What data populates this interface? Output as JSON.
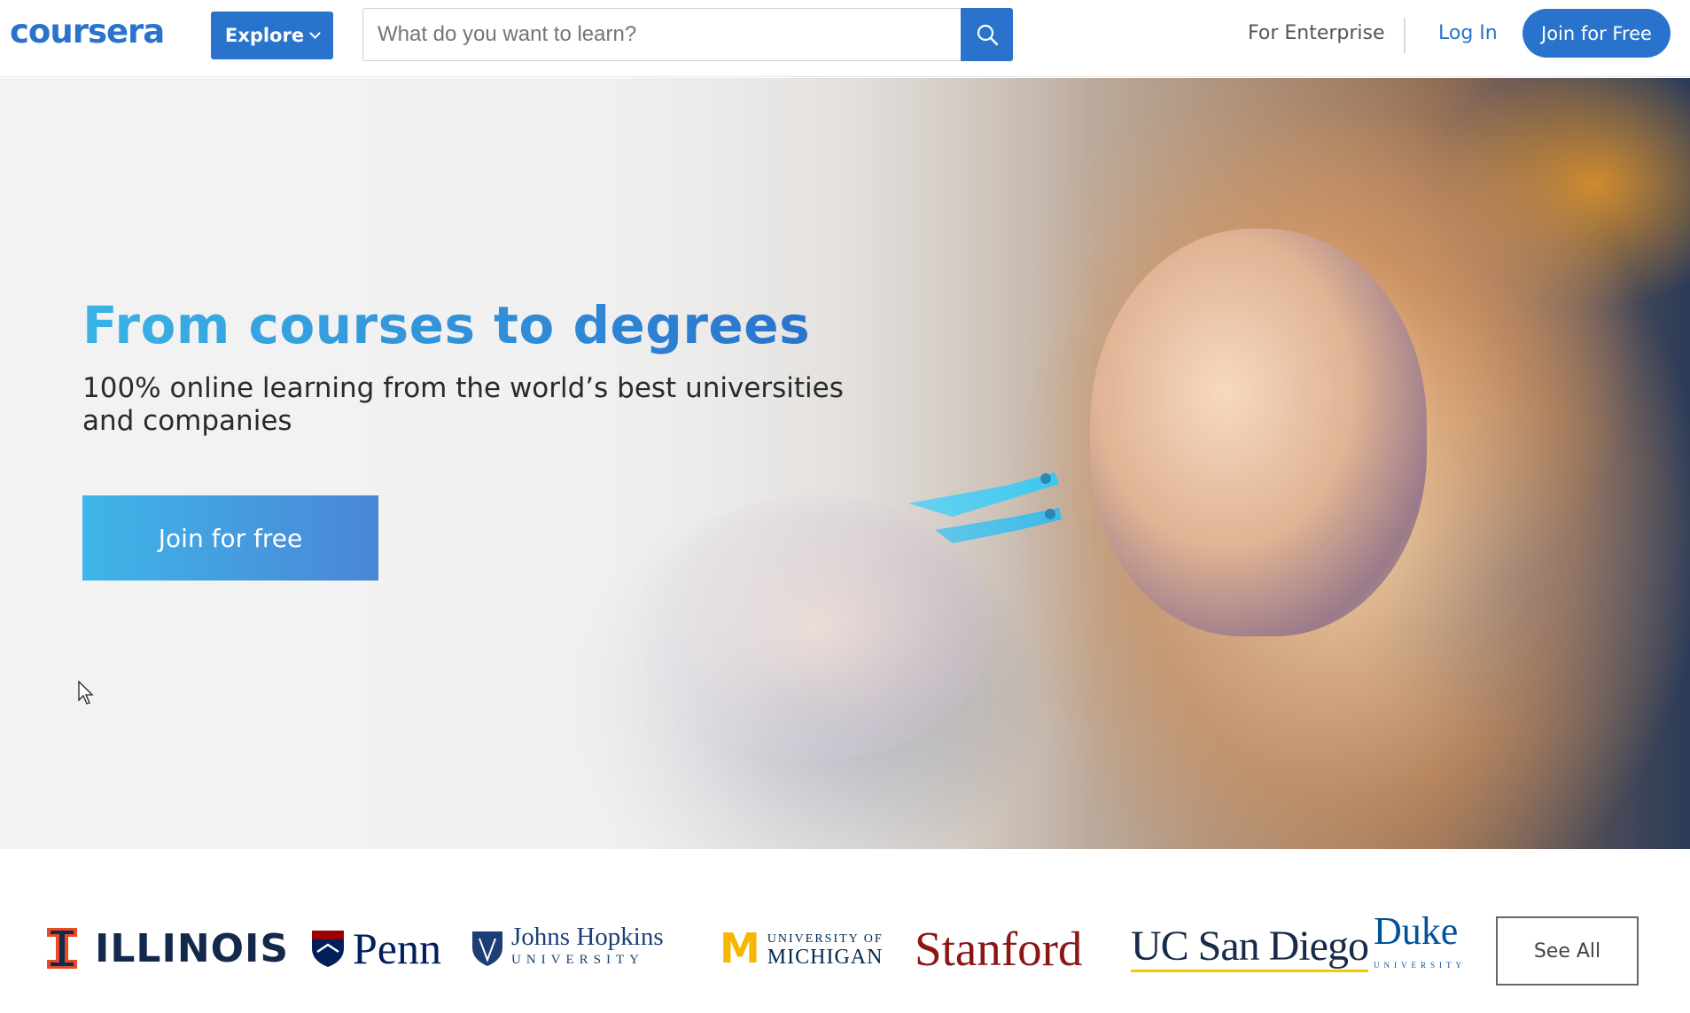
{
  "header": {
    "logo": "coursera",
    "explore_label": "Explore",
    "search_placeholder": "What do you want to learn?",
    "search_icon": "search-icon",
    "nav_enterprise": "For Enterprise",
    "nav_login": "Log In",
    "join_label": "Join for Free",
    "accent_color": "#2a73cc"
  },
  "hero": {
    "title": "From courses to degrees",
    "subtitle": "100% online learning from the world’s best universities and companies",
    "cta_label": "Join for free"
  },
  "partners": {
    "logos": [
      {
        "name": "ILLINOIS"
      },
      {
        "name": "Penn"
      },
      {
        "name": "Johns Hopkins",
        "sub": "UNIVERSITY"
      },
      {
        "name_top": "UNIVERSITY OF",
        "name": "MICHIGAN"
      },
      {
        "name": "Stanford"
      },
      {
        "name": "UC San Diego"
      },
      {
        "name": "Duke",
        "sub": "UNIVERSITY"
      }
    ],
    "see_all_label": "See All"
  }
}
